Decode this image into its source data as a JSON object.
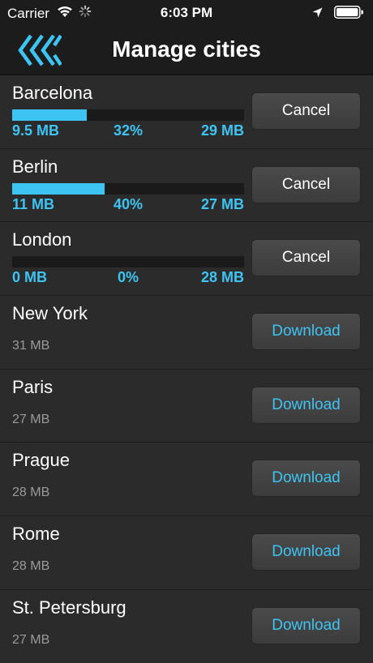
{
  "status_bar": {
    "carrier": "Carrier",
    "time": "6:03 PM",
    "icons": [
      "wifi-icon",
      "activity-spinner-icon",
      "location-arrow-icon",
      "battery-icon"
    ]
  },
  "nav": {
    "title": "Manage cities",
    "back_icon": "triple-chevron-left-icon"
  },
  "colors": {
    "accent": "#3ec4f2",
    "background": "#2b2b2b",
    "bar_background": "#1c1c1c",
    "button": "#444444"
  },
  "cities": [
    {
      "name": "Barcelona",
      "downloading": true,
      "progress": 0.32,
      "downloaded": "9.5 MB",
      "percent": "32%",
      "total": "29 MB",
      "action": "Cancel"
    },
    {
      "name": "Berlin",
      "downloading": true,
      "progress": 0.4,
      "downloaded": "11 MB",
      "percent": "40%",
      "total": "27 MB",
      "action": "Cancel"
    },
    {
      "name": "London",
      "downloading": true,
      "progress": 0,
      "downloaded": "0 MB",
      "percent": "0%",
      "total": "28 MB",
      "action": "Cancel"
    },
    {
      "name": "New York",
      "downloading": false,
      "size": "31 MB",
      "action": "Download"
    },
    {
      "name": "Paris",
      "downloading": false,
      "size": "27 MB",
      "action": "Download"
    },
    {
      "name": "Prague",
      "downloading": false,
      "size": "28 MB",
      "action": "Download"
    },
    {
      "name": "Rome",
      "downloading": false,
      "size": "28 MB",
      "action": "Download"
    },
    {
      "name": "St. Petersburg",
      "downloading": false,
      "size": "27 MB",
      "action": "Download"
    }
  ]
}
